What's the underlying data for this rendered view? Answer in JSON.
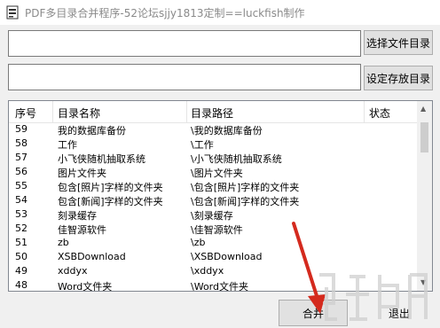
{
  "window": {
    "title": "PDF多目录合并程序-52论坛sjjy1813定制==luckfish制作"
  },
  "buttons": {
    "choose_dir": "选择文件目录",
    "set_save": "设定存放目录",
    "merge": "合并",
    "exit": "退出"
  },
  "fields": {
    "source_dir": "",
    "save_dir": ""
  },
  "table": {
    "headers": [
      "序号",
      "目录名称",
      "目录路径",
      "状态"
    ],
    "rows": [
      [
        "59",
        "我的数据库备份",
        "\\我的数据库备份",
        ""
      ],
      [
        "58",
        "工作",
        "\\工作",
        ""
      ],
      [
        "57",
        "小飞侠随机抽取系统",
        "\\小飞侠随机抽取系统",
        ""
      ],
      [
        "56",
        "图片文件夹",
        "\\图片文件夹",
        ""
      ],
      [
        "55",
        "包含[照片]字样的文件夹",
        "\\包含[照片]字样的文件夹",
        ""
      ],
      [
        "54",
        "包含[新闻]字样的文件夹",
        "\\包含[新闻]字样的文件夹",
        ""
      ],
      [
        "53",
        "刻录缓存",
        "\\刻录缓存",
        ""
      ],
      [
        "52",
        "佳智源软件",
        "\\佳智源软件",
        ""
      ],
      [
        "51",
        "zb",
        "\\zb",
        ""
      ],
      [
        "50",
        "XSBDownload",
        "\\XSBDownload",
        ""
      ],
      [
        "49",
        "xddyx",
        "\\xddyx",
        ""
      ],
      [
        "48",
        "Word文件夹",
        "\\Word文件夹",
        ""
      ]
    ]
  },
  "colors": {
    "arrow": "#d42a1e",
    "title_text": "#8a8a8a"
  }
}
